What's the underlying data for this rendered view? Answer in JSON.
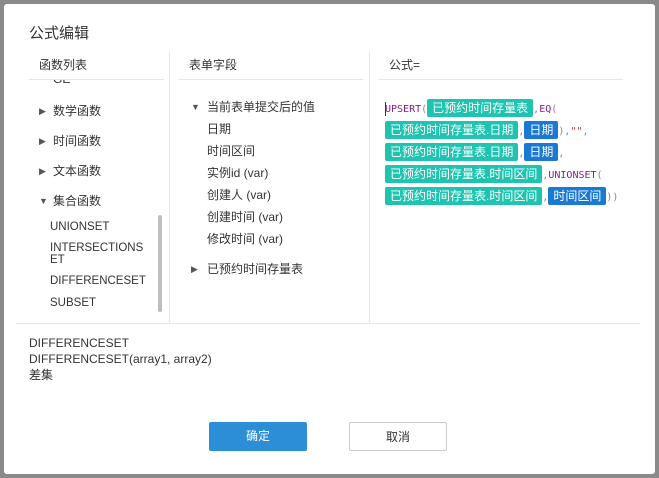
{
  "dialog": {
    "title": "公式编辑",
    "ok_label": "确定",
    "cancel_label": "取消"
  },
  "functions": {
    "header": "函数列表",
    "partial_label": "GE",
    "groups": [
      {
        "label": "数学函数",
        "expanded": false
      },
      {
        "label": "时间函数",
        "expanded": false
      },
      {
        "label": "文本函数",
        "expanded": false
      },
      {
        "label": "集合函数",
        "expanded": true
      }
    ],
    "set_functions": [
      "UNIONSET",
      "INTERSECTIONSET",
      "DIFFERENCESET",
      "SUBSET"
    ],
    "set_function_wrapped": {
      "line1": "INTERSECTIONS",
      "line2": "ET"
    }
  },
  "fields": {
    "header": "表单字段",
    "current_form": {
      "label": "当前表单提交后的值",
      "items": [
        "日期",
        "时间区间",
        "实例id (var)",
        "创建人 (var)",
        "创建时间 (var)",
        "修改时间 (var)"
      ]
    },
    "other_form": {
      "label": "已预约时间存量表"
    }
  },
  "formula": {
    "header": "公式=",
    "tokens": {
      "upsert": "UPSERT",
      "open": "(",
      "comma": ",",
      "eq": "EQ",
      "close2": "),",
      "empty_str": "\"\"",
      "unions_a": "UNIONS",
      "unions_b": "ET",
      "end": "))",
      "field_table": "已预约时间存量表",
      "field_date": "已预约时间存量表.日期",
      "var_date": "日期",
      "field_range": "已预约时间存量表.时间区间",
      "var_range": "时间区间"
    }
  },
  "description": {
    "name": "DIFFERENCESET",
    "signature": "DIFFERENCESET(array1, array2)",
    "meaning": "差集"
  },
  "colors": {
    "primary_button": "#2b8ed6",
    "field_tag": "#1ec4b0",
    "variable_tag": "#1a7ad3",
    "keyword": "#8b1b8f",
    "string": "#c23b22"
  }
}
